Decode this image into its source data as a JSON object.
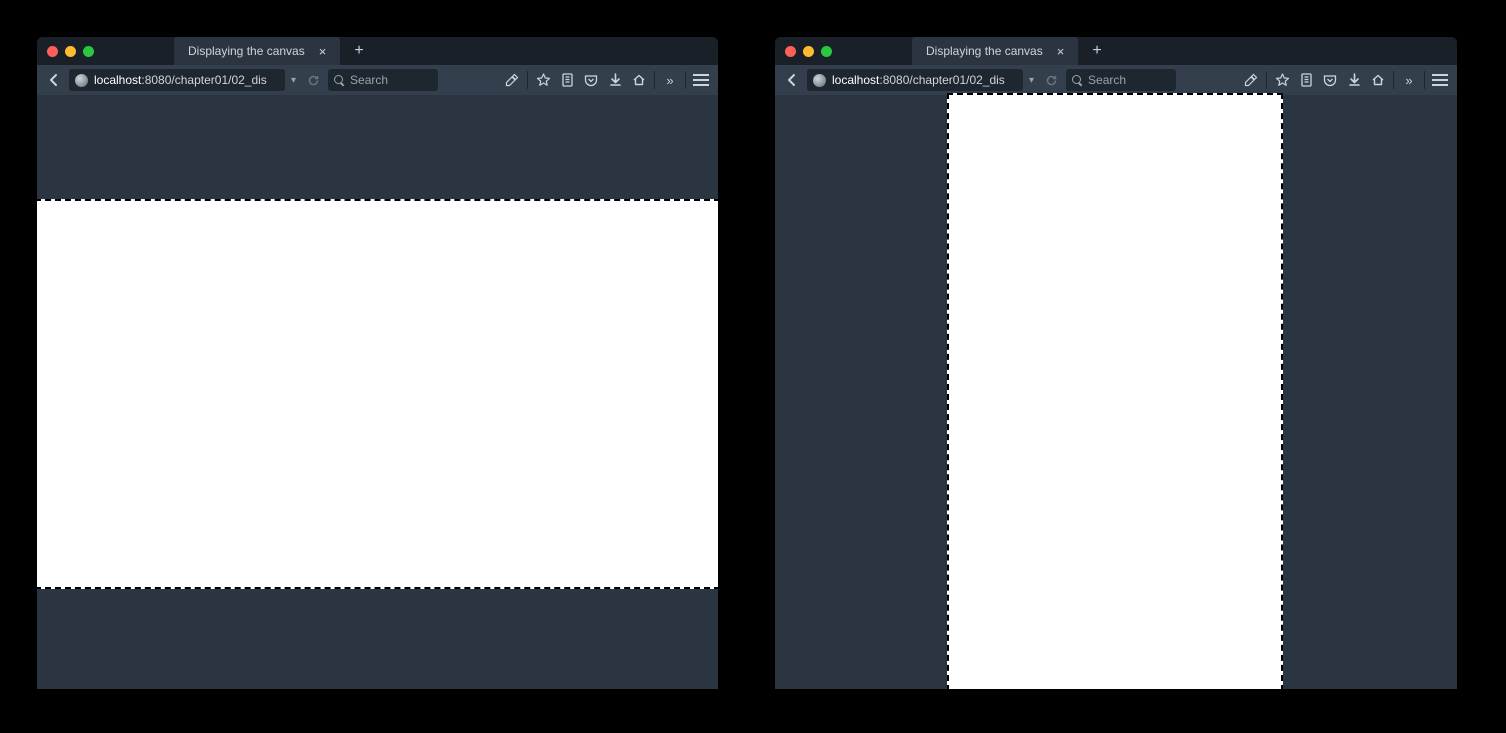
{
  "windows": [
    {
      "tab_title": "Displaying the canvas",
      "url_highlight": "localhost",
      "url_rest": ":8080/chapter01/02_dis",
      "search_placeholder": "Search"
    },
    {
      "tab_title": "Displaying the canvas",
      "url_highlight": "localhost",
      "url_rest": ":8080/chapter01/02_dis",
      "search_placeholder": "Search"
    }
  ],
  "icons": {
    "close_glyph": "×",
    "plus_glyph": "+",
    "chevron_more": "»"
  }
}
